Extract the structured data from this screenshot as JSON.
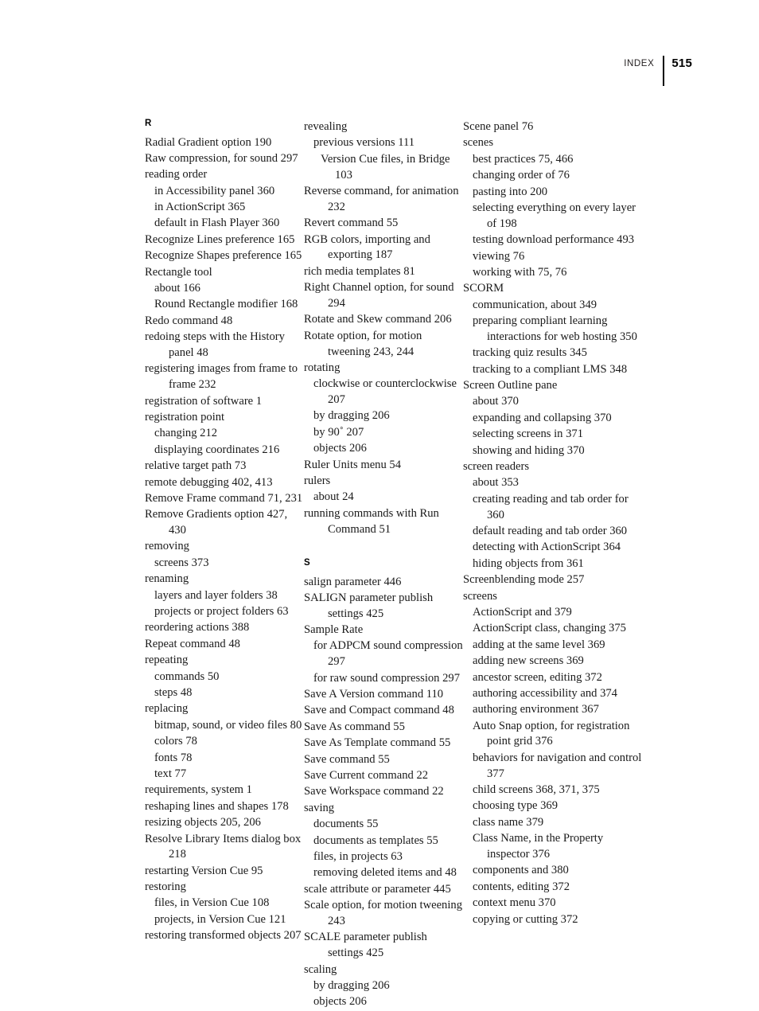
{
  "header": {
    "label": "INDEX",
    "page_number": "515"
  },
  "columns": [
    {
      "id": "column-1",
      "blocks": [
        {
          "type": "letter",
          "text": "R"
        },
        {
          "type": "entry",
          "level": 0,
          "text": "Radial Gradient option 190"
        },
        {
          "type": "entry",
          "level": 0,
          "text": "Raw compression, for sound 297"
        },
        {
          "type": "entry",
          "level": 0,
          "text": "reading order"
        },
        {
          "type": "entry",
          "level": 1,
          "text": "in Accessibility panel 360"
        },
        {
          "type": "entry",
          "level": 1,
          "text": "in ActionScript 365"
        },
        {
          "type": "entry",
          "level": 1,
          "text": "default in Flash Player 360"
        },
        {
          "type": "entry",
          "level": 0,
          "text": "Recognize Lines preference 165"
        },
        {
          "type": "entry",
          "level": 0,
          "text": "Recognize Shapes preference 165"
        },
        {
          "type": "entry",
          "level": 0,
          "text": "Rectangle tool"
        },
        {
          "type": "entry",
          "level": 1,
          "text": "about 166"
        },
        {
          "type": "entry",
          "level": 1,
          "text": "Round Rectangle modifier 168"
        },
        {
          "type": "entry",
          "level": 0,
          "text": "Redo command 48"
        },
        {
          "type": "entry",
          "level": 0,
          "text": "redoing steps with the History panel 48"
        },
        {
          "type": "entry",
          "level": 0,
          "text": "registering images from frame to frame 232"
        },
        {
          "type": "entry",
          "level": 0,
          "text": "registration of software 1"
        },
        {
          "type": "entry",
          "level": 0,
          "text": "registration point"
        },
        {
          "type": "entry",
          "level": 1,
          "text": "changing 212"
        },
        {
          "type": "entry",
          "level": 1,
          "text": "displaying coordinates 216"
        },
        {
          "type": "entry",
          "level": 0,
          "text": "relative target path 73"
        },
        {
          "type": "entry",
          "level": 0,
          "text": "remote debugging 402, 413"
        },
        {
          "type": "entry",
          "level": 0,
          "text": "Remove Frame command 71, 231"
        },
        {
          "type": "entry",
          "level": 0,
          "text": "Remove Gradients option 427, 430"
        },
        {
          "type": "entry",
          "level": 0,
          "text": "removing"
        },
        {
          "type": "entry",
          "level": 1,
          "text": "screens 373"
        },
        {
          "type": "entry",
          "level": 0,
          "text": "renaming"
        },
        {
          "type": "entry",
          "level": 1,
          "text": "layers and layer folders 38"
        },
        {
          "type": "entry",
          "level": 1,
          "text": "projects or project folders 63"
        },
        {
          "type": "entry",
          "level": 0,
          "text": "reordering actions 388"
        },
        {
          "type": "entry",
          "level": 0,
          "text": "Repeat command 48"
        },
        {
          "type": "entry",
          "level": 0,
          "text": "repeating"
        },
        {
          "type": "entry",
          "level": 1,
          "text": "commands 50"
        },
        {
          "type": "entry",
          "level": 1,
          "text": "steps 48"
        },
        {
          "type": "entry",
          "level": 0,
          "text": "replacing"
        },
        {
          "type": "entry",
          "level": 1,
          "text": "bitmap, sound, or video files 80"
        },
        {
          "type": "entry",
          "level": 1,
          "text": "colors 78"
        },
        {
          "type": "entry",
          "level": 1,
          "text": "fonts 78"
        },
        {
          "type": "entry",
          "level": 1,
          "text": "text 77"
        },
        {
          "type": "entry",
          "level": 0,
          "text": "requirements, system 1"
        },
        {
          "type": "entry",
          "level": 0,
          "text": "reshaping lines and shapes 178"
        },
        {
          "type": "entry",
          "level": 0,
          "text": "resizing objects 205, 206"
        },
        {
          "type": "entry",
          "level": 0,
          "text": "Resolve Library Items dialog box 218"
        },
        {
          "type": "entry",
          "level": 0,
          "text": "restarting Version Cue 95"
        },
        {
          "type": "entry",
          "level": 0,
          "text": "restoring"
        },
        {
          "type": "entry",
          "level": 1,
          "text": "files, in Version Cue 108"
        },
        {
          "type": "entry",
          "level": 1,
          "text": "projects, in Version Cue 121"
        },
        {
          "type": "entry",
          "level": 0,
          "text": "restoring transformed objects 207"
        }
      ]
    },
    {
      "id": "column-2",
      "blocks": [
        {
          "type": "entry",
          "level": 0,
          "text": "revealing"
        },
        {
          "type": "entry",
          "level": 1,
          "text": "previous versions 111"
        },
        {
          "type": "entry",
          "level": 2,
          "text": "Version Cue files, in Bridge 103"
        },
        {
          "type": "entry",
          "level": 0,
          "text": "Reverse command, for animation 232"
        },
        {
          "type": "entry",
          "level": 0,
          "text": "Revert command 55"
        },
        {
          "type": "entry",
          "level": 0,
          "text": "RGB colors, importing and exporting 187"
        },
        {
          "type": "entry",
          "level": 0,
          "text": "rich media templates 81"
        },
        {
          "type": "entry",
          "level": 0,
          "text": "Right Channel option, for sound 294"
        },
        {
          "type": "entry",
          "level": 0,
          "text": "Rotate and Skew command 206"
        },
        {
          "type": "entry",
          "level": 0,
          "text": "Rotate option, for motion tweening 243, 244"
        },
        {
          "type": "entry",
          "level": 0,
          "text": "rotating"
        },
        {
          "type": "entry",
          "level": 1,
          "text": "clockwise or counterclockwise 207"
        },
        {
          "type": "entry",
          "level": 1,
          "text": "by dragging 206"
        },
        {
          "type": "entry",
          "level": 1,
          "text": "by 90˚ 207"
        },
        {
          "type": "entry",
          "level": 1,
          "text": "objects 206"
        },
        {
          "type": "entry",
          "level": 0,
          "text": "Ruler Units menu 54"
        },
        {
          "type": "entry",
          "level": 0,
          "text": "rulers"
        },
        {
          "type": "entry",
          "level": 1,
          "text": "about 24"
        },
        {
          "type": "entry",
          "level": 0,
          "text": "running commands with Run Command 51"
        },
        {
          "type": "letter",
          "text": "S",
          "spaced": true
        },
        {
          "type": "entry",
          "level": 0,
          "text": "salign parameter 446"
        },
        {
          "type": "entry",
          "level": 0,
          "text": "SALIGN parameter publish settings 425"
        },
        {
          "type": "entry",
          "level": 0,
          "text": "Sample Rate"
        },
        {
          "type": "entry",
          "level": 1,
          "text": "for ADPCM sound compression 297"
        },
        {
          "type": "entry",
          "level": 1,
          "text": "for raw sound compression 297"
        },
        {
          "type": "entry",
          "level": 0,
          "text": "Save A Version command 110"
        },
        {
          "type": "entry",
          "level": 0,
          "text": "Save and Compact command 48"
        },
        {
          "type": "entry",
          "level": 0,
          "text": "Save As command 55"
        },
        {
          "type": "entry",
          "level": 0,
          "text": "Save As Template command 55"
        },
        {
          "type": "entry",
          "level": 0,
          "text": "Save command 55"
        },
        {
          "type": "entry",
          "level": 0,
          "text": "Save Current command 22"
        },
        {
          "type": "entry",
          "level": 0,
          "text": "Save Workspace command 22"
        },
        {
          "type": "entry",
          "level": 0,
          "text": "saving"
        },
        {
          "type": "entry",
          "level": 1,
          "text": "documents 55"
        },
        {
          "type": "entry",
          "level": 1,
          "text": "documents as templates 55"
        },
        {
          "type": "entry",
          "level": 1,
          "text": "files, in projects 63"
        },
        {
          "type": "entry",
          "level": 1,
          "text": "removing deleted items and 48"
        },
        {
          "type": "entry",
          "level": 0,
          "text": "scale attribute or parameter 445"
        },
        {
          "type": "entry",
          "level": 0,
          "text": "Scale option, for motion tweening 243"
        },
        {
          "type": "entry",
          "level": 0,
          "text": "SCALE parameter publish settings 425"
        },
        {
          "type": "entry",
          "level": 0,
          "text": "scaling"
        },
        {
          "type": "entry",
          "level": 1,
          "text": "by dragging 206"
        },
        {
          "type": "entry",
          "level": 1,
          "text": "objects 206"
        }
      ]
    },
    {
      "id": "column-3",
      "blocks": [
        {
          "type": "entry",
          "level": 0,
          "text": "Scene panel 76"
        },
        {
          "type": "entry",
          "level": 0,
          "text": "scenes"
        },
        {
          "type": "entry",
          "level": 1,
          "text": "best practices 75, 466"
        },
        {
          "type": "entry",
          "level": 1,
          "text": "changing order of 76"
        },
        {
          "type": "entry",
          "level": 1,
          "text": "pasting into 200"
        },
        {
          "type": "entry",
          "level": 1,
          "text": "selecting everything on every layer of 198"
        },
        {
          "type": "entry",
          "level": 1,
          "text": "testing download performance 493"
        },
        {
          "type": "entry",
          "level": 1,
          "text": "viewing 76"
        },
        {
          "type": "entry",
          "level": 1,
          "text": "working with 75, 76"
        },
        {
          "type": "entry",
          "level": 0,
          "text": "SCORM"
        },
        {
          "type": "entry",
          "level": 1,
          "text": "communication, about 349"
        },
        {
          "type": "entry",
          "level": 1,
          "text": "preparing compliant learning interactions for web hosting 350"
        },
        {
          "type": "entry",
          "level": 1,
          "text": "tracking quiz results 345"
        },
        {
          "type": "entry",
          "level": 1,
          "text": "tracking to a compliant LMS 348"
        },
        {
          "type": "entry",
          "level": 0,
          "text": "Screen Outline pane"
        },
        {
          "type": "entry",
          "level": 1,
          "text": "about 370"
        },
        {
          "type": "entry",
          "level": 1,
          "text": "expanding and collapsing 370"
        },
        {
          "type": "entry",
          "level": 1,
          "text": "selecting screens in 371"
        },
        {
          "type": "entry",
          "level": 1,
          "text": "showing and hiding 370"
        },
        {
          "type": "entry",
          "level": 0,
          "text": "screen readers"
        },
        {
          "type": "entry",
          "level": 1,
          "text": "about 353"
        },
        {
          "type": "entry",
          "level": 1,
          "text": "creating reading and tab order for 360"
        },
        {
          "type": "entry",
          "level": 1,
          "text": "default reading and tab order 360"
        },
        {
          "type": "entry",
          "level": 1,
          "text": "detecting with ActionScript 364"
        },
        {
          "type": "entry",
          "level": 1,
          "text": "hiding objects from 361"
        },
        {
          "type": "entry",
          "level": 0,
          "text": "Screenblending mode 257"
        },
        {
          "type": "entry",
          "level": 0,
          "text": "screens"
        },
        {
          "type": "entry",
          "level": 1,
          "text": "ActionScript and 379"
        },
        {
          "type": "entry",
          "level": 1,
          "text": "ActionScript class, changing 375"
        },
        {
          "type": "entry",
          "level": 1,
          "text": "adding at the same level 369"
        },
        {
          "type": "entry",
          "level": 1,
          "text": "adding new screens 369"
        },
        {
          "type": "entry",
          "level": 1,
          "text": "ancestor screen, editing 372"
        },
        {
          "type": "entry",
          "level": 1,
          "text": "authoring accessibility and 374"
        },
        {
          "type": "entry",
          "level": 1,
          "text": "authoring environment 367"
        },
        {
          "type": "entry",
          "level": 1,
          "text": "Auto Snap option, for registration point grid 376"
        },
        {
          "type": "entry",
          "level": 1,
          "text": "behaviors for navigation and control 377"
        },
        {
          "type": "entry",
          "level": 1,
          "text": "child screens 368, 371, 375"
        },
        {
          "type": "entry",
          "level": 1,
          "text": "choosing type 369"
        },
        {
          "type": "entry",
          "level": 1,
          "text": "class name 379"
        },
        {
          "type": "entry",
          "level": 1,
          "text": "Class Name, in the Property inspector 376"
        },
        {
          "type": "entry",
          "level": 1,
          "text": "components and 380"
        },
        {
          "type": "entry",
          "level": 1,
          "text": "contents, editing 372"
        },
        {
          "type": "entry",
          "level": 1,
          "text": "context menu 370"
        },
        {
          "type": "entry",
          "level": 1,
          "text": "copying or cutting 372"
        }
      ]
    }
  ]
}
